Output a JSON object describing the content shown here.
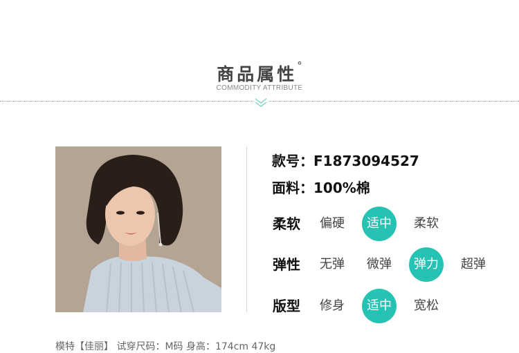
{
  "section": {
    "title": "商品属性",
    "title_mark": "°",
    "subtitle": "COMMODITY ATTRIBUTE"
  },
  "product": {
    "style_no": "款号：F1873094527",
    "fabric": "面料：100%棉"
  },
  "attributes": {
    "softness": {
      "label": "柔软",
      "options": [
        "偏硬",
        "适中",
        "柔软"
      ],
      "selected": "适中"
    },
    "elasticity": {
      "label": "弹性",
      "options": [
        "无弹",
        "微弹",
        "弹力",
        "超弹"
      ],
      "selected": "弹力"
    },
    "fit": {
      "label": "版型",
      "options": [
        "修身",
        "适中",
        "宽松"
      ],
      "selected": "适中"
    }
  },
  "model_caption": "模特【佳丽】 试穿尺码：M码  身高：174cm 47kg",
  "colors": {
    "accent": "#26c3b4"
  },
  "icons": {
    "divider": "double-chevron-down-icon"
  }
}
